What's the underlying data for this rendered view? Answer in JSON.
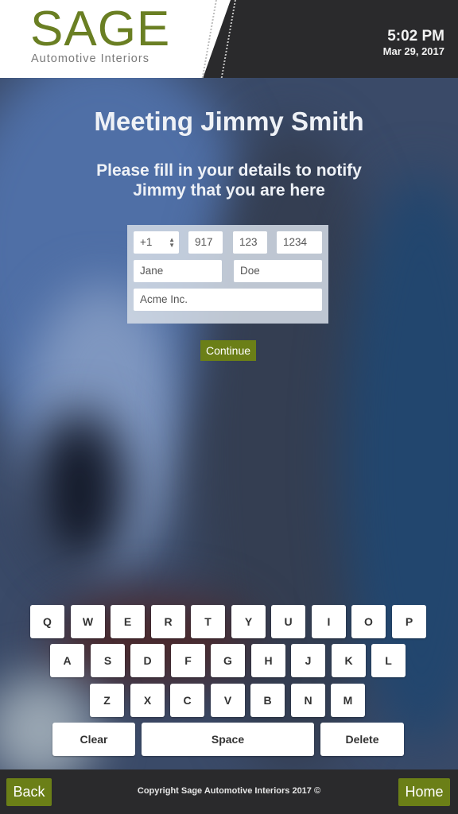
{
  "header": {
    "logo_word": "SAGE",
    "logo_subtitle": "Automotive Interiors",
    "time": "5:02 PM",
    "date": "Mar 29, 2017"
  },
  "main": {
    "title": "Meeting Jimmy Smith",
    "subtitle_line1": "Please fill in your details to notify",
    "subtitle_line2": "Jimmy that you are here",
    "form": {
      "country_code": "+1",
      "phone_area": "917",
      "phone_prefix": "123",
      "phone_line": "1234",
      "first_name": "Jane",
      "last_name": "Doe",
      "company": "Acme Inc."
    },
    "continue_label": "Continue"
  },
  "keyboard": {
    "row1": [
      "Q",
      "W",
      "E",
      "R",
      "T",
      "Y",
      "U",
      "I",
      "O",
      "P"
    ],
    "row2": [
      "A",
      "S",
      "D",
      "F",
      "G",
      "H",
      "J",
      "K",
      "L"
    ],
    "row3": [
      "Z",
      "X",
      "C",
      "V",
      "B",
      "N",
      "M"
    ],
    "clear_label": "Clear",
    "space_label": "Space",
    "delete_label": "Delete"
  },
  "footer": {
    "back_label": "Back",
    "copyright": "Copyright Sage Automotive Interiors 2017 ©",
    "home_label": "Home"
  },
  "colors": {
    "brand_green": "#6b7f17",
    "header_dark": "#2a2a2c"
  }
}
